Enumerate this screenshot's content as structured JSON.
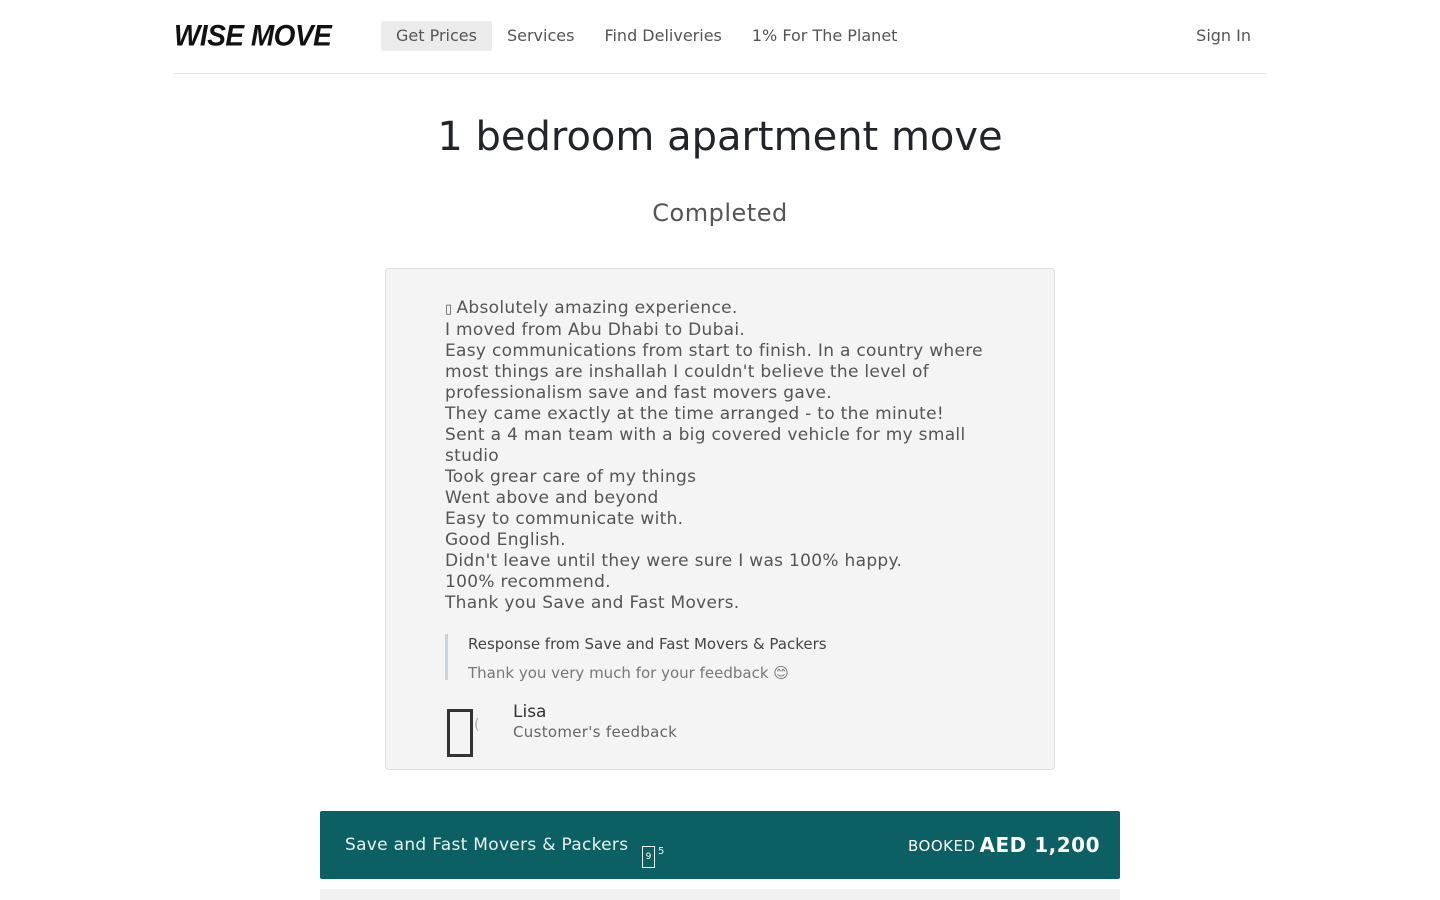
{
  "header": {
    "logo": "WISE MOVE",
    "nav": [
      "Get Prices",
      "Services",
      "Find Deliveries",
      "1% For The Planet"
    ],
    "sign_in": "Sign In"
  },
  "page": {
    "title": "1 bedroom apartment move",
    "status": "Completed"
  },
  "review": {
    "quote_icon": "quote-icon",
    "lines": [
      "Absolutely amazing experience.",
      "I moved from Abu Dhabi to Dubai.",
      "Easy communications from start to finish. In a country where most things are inshallah I couldn't believe the level of professionalism save and fast movers gave.",
      "They came exactly at the time arranged - to the minute!",
      "Sent a 4 man team with a big covered vehicle for my small studio",
      "Took grear care of my things",
      "Went above and beyond",
      "Easy to communicate with.",
      "Good English.",
      "Didn't leave until they were sure I was 100% happy.",
      "100% recommend.",
      "Thank you Save and Fast Movers."
    ],
    "response_title": "Response from Save and Fast Movers & Packers",
    "response_text": "Thank you very much for your feedback 😊",
    "author_name": "Lisa",
    "author_role": "Customer's feedback"
  },
  "booking": {
    "company": "Save and Fast Movers & Packers",
    "rating": "9",
    "rating_small": "5",
    "status": "BOOKED",
    "price": "AED 1,200",
    "color": "#0c5f63"
  }
}
